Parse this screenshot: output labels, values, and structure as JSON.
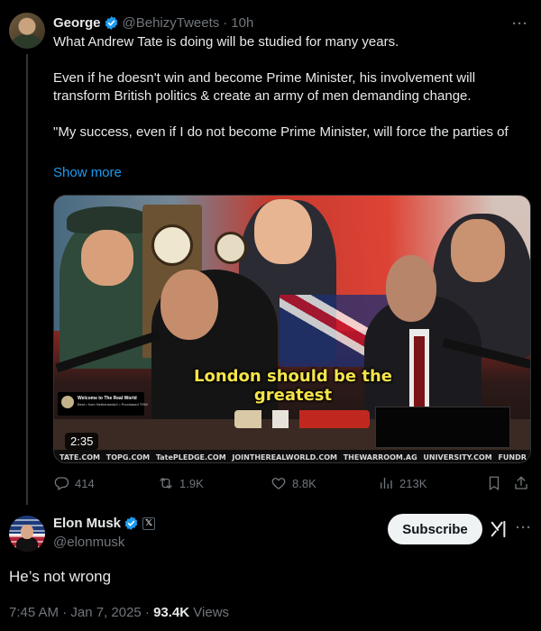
{
  "parent_tweet": {
    "author": {
      "name": "George",
      "handle": "@BehizyTweets",
      "time": "10h"
    },
    "text": {
      "p1": "What Andrew Tate is doing will be studied for many years.",
      "p2": "Even if he doesn't win and become Prime Minister, his involvement will transform British politics & create an army of men demanding change.",
      "p3": "\"My success, even if I do not become Prime Minister, will force the parties of"
    },
    "show_more_label": "Show more",
    "media": {
      "caption_line1": "London should be the",
      "caption_line2": "greatest",
      "duration": "2:35",
      "logo_card": {
        "title": "Welcome to The Real World",
        "subtitle": "Best • from NetherlandsX • Purchased TRW"
      },
      "ticker": [
        "TATE.COM",
        "TOPG.COM",
        "TatePLEDGE.COM",
        "JOINTHEREALWORLD.COM",
        "THEWARROOM.AG",
        "UNIVERSITY.COM",
        "FUNDR"
      ]
    },
    "actions": {
      "replies": "414",
      "reposts": "1.9K",
      "likes": "8.8K",
      "views": "213K"
    }
  },
  "main_tweet": {
    "author": {
      "name": "Elon Musk",
      "handle": "@elonmusk"
    },
    "subscribe_label": "Subscribe",
    "text": "He’s not wrong",
    "timestamp": "7:45 AM · Jan 7, 2025 · ",
    "views_count": "93.4K",
    "views_label": " Views"
  },
  "colors": {
    "background": "#000000",
    "text": "#e7e9ea",
    "muted": "#71767b",
    "link": "#1d9bf0",
    "verified": "#1d9bf0",
    "caption": "#f5e34a"
  },
  "icons": [
    "verified-badge-icon",
    "more-icon",
    "reply-icon",
    "repost-icon",
    "like-icon",
    "views-icon",
    "bookmark-icon",
    "share-icon",
    "x-badge-icon",
    "grok-icon"
  ]
}
